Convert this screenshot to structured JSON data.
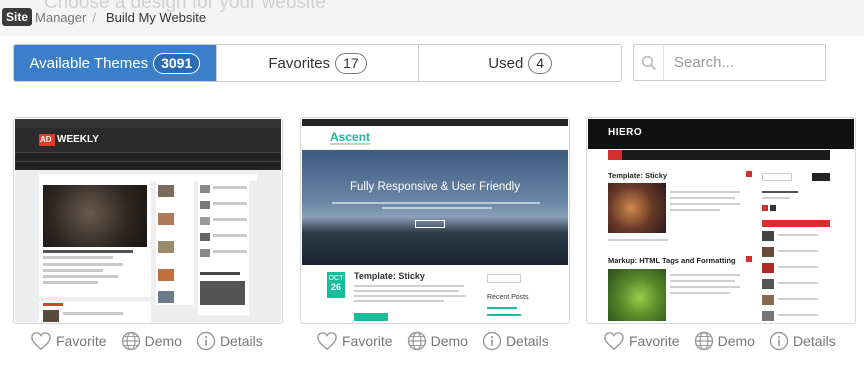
{
  "header": {
    "ghost_title": "Choose a design for your website",
    "logo": "Site",
    "breadcrumb": [
      {
        "label": "Manager"
      },
      {
        "label": "Build My Website"
      }
    ]
  },
  "tabs": [
    {
      "label": "Available Themes",
      "count": "3091",
      "active": true
    },
    {
      "label": "Favorites",
      "count": "17",
      "active": false
    },
    {
      "label": "Used",
      "count": "4",
      "active": false
    }
  ],
  "search": {
    "placeholder": "Search..."
  },
  "actions": {
    "favorite": "Favorite",
    "demo": "Demo",
    "details": "Details"
  },
  "themes": [
    {
      "logo_prefix": "AD",
      "logo_text": "WEEKLY"
    },
    {
      "logo": "Ascent",
      "hero_title": "Fully Responsive & User Friendly",
      "date_month": "OCT",
      "date_day": "26",
      "post_title": "Template: Sticky",
      "recent_label": "Recent Posts"
    },
    {
      "logo": "HIERO",
      "post1_title": "Template: Sticky",
      "post2_title": "Markup: HTML Tags and Formatting"
    }
  ],
  "colors": {
    "accent_blue": "#3b7fc9",
    "ascent_teal": "#1abc9c",
    "hiero_red": "#d32f2f",
    "adweekly_red": "#e23c2b"
  }
}
